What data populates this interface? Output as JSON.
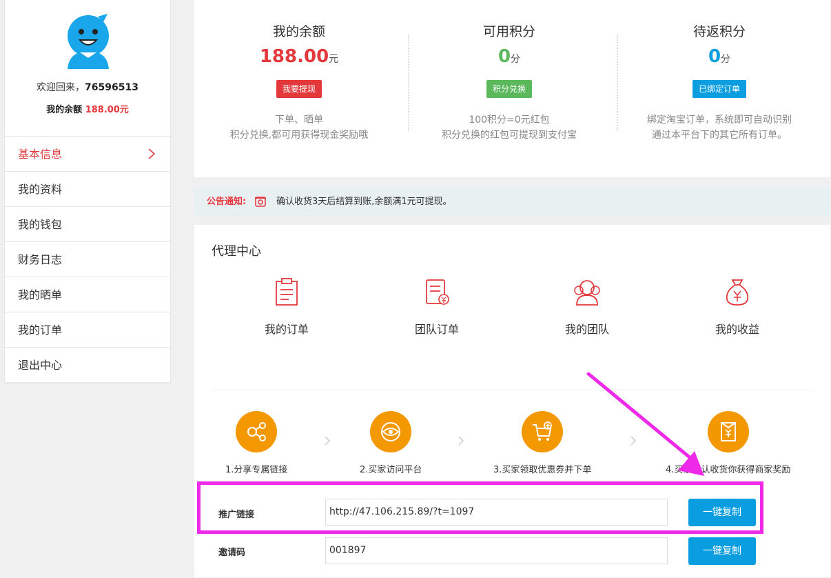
{
  "sidebar": {
    "welcome_prefix": "欢迎回来，",
    "username": "76596513",
    "balance_label": "我的余额",
    "balance_value": "188.00元",
    "menu": [
      "基本信息",
      "我的资料",
      "我的钱包",
      "财务日志",
      "我的晒单",
      "我的订单",
      "退出中心"
    ]
  },
  "stats": [
    {
      "label": "我的余额",
      "value": "188.00",
      "unit": "元",
      "button": "我要提现",
      "desc1": "下单、晒单",
      "desc2": "积分兑换,都可用获得现金奖励哦",
      "color": "#e4393c"
    },
    {
      "label": "可用积分",
      "value": "0",
      "unit": "分",
      "button": "积分兑换",
      "desc1": "100积分=0元红包",
      "desc2": "积分兑换的红包可提现到支付宝",
      "color": "#5cb85c"
    },
    {
      "label": "待返积分",
      "value": "0",
      "unit": "分",
      "button": "已绑定订单",
      "desc1": "绑定淘宝订单，系统即可自动识别",
      "desc2": "通过本平台下的其它所有订单。",
      "color": "#0a9ee0"
    }
  ],
  "notice": {
    "label": "公告通知:",
    "text": "确认收货3天后结算到账,余额满1元可提现。"
  },
  "agent": {
    "title": "代理中心",
    "tools": [
      "我的订单",
      "团队订单",
      "我的团队",
      "我的收益"
    ],
    "steps": [
      "1.分享专属链接",
      "2.买家访问平台",
      "3.买家领取优惠券并下单",
      "4.买家确认收货你获得商家奖励"
    ],
    "promo_label": "推广链接",
    "promo_value": "http://47.106.215.89/?t=1097",
    "invite_label": "邀请码",
    "invite_value": "001897",
    "copy_label": "一键复制"
  },
  "colors": {
    "accent_red": "#e4393c",
    "accent_blue": "#0a9ee0",
    "step_orange": "#f39800",
    "highlight": "#ee2ae8"
  }
}
